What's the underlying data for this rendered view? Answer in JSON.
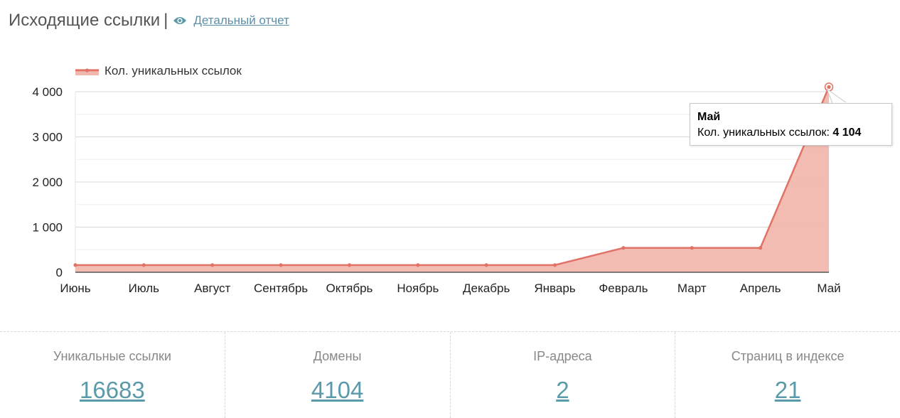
{
  "header": {
    "title": "Исходящие ссылки",
    "separator": "|",
    "report_link": "Детальный отчет"
  },
  "chart_data": {
    "type": "area",
    "title": "",
    "xlabel": "",
    "ylabel": "",
    "categories": [
      "Июнь",
      "Июль",
      "Август",
      "Сентябрь",
      "Октябрь",
      "Ноябрь",
      "Декабрь",
      "Январь",
      "Февраль",
      "Март",
      "Апрель",
      "Май"
    ],
    "series": [
      {
        "name": "Кол. уникальных ссылок",
        "values": [
          160,
          160,
          160,
          160,
          160,
          160,
          160,
          160,
          540,
          540,
          540,
          4104
        ],
        "color": "#e07366"
      }
    ],
    "ylim": [
      0,
      4000
    ],
    "yticks": [
      0,
      1000,
      2000,
      3000,
      4000
    ],
    "ytick_labels": [
      "0",
      "1 000",
      "2 000",
      "3 000",
      "4 000"
    ],
    "grid": true,
    "legend_position": "top-left"
  },
  "tooltip": {
    "title": "Май",
    "label": "Кол. уникальных ссылок:",
    "value": "4 104"
  },
  "stats": [
    {
      "label": "Уникальные ссылки",
      "value": "16683"
    },
    {
      "label": "Домены",
      "value": "4104"
    },
    {
      "label": "IP-адреса",
      "value": "2"
    },
    {
      "label": "Страниц в индексе",
      "value": "21"
    }
  ],
  "colors": {
    "series_line": "#e07366",
    "series_fill": "#f2b8ae",
    "link": "#5b8fa8",
    "stat_value": "#5b9aaa"
  },
  "icons": {
    "report": "eye-icon"
  }
}
